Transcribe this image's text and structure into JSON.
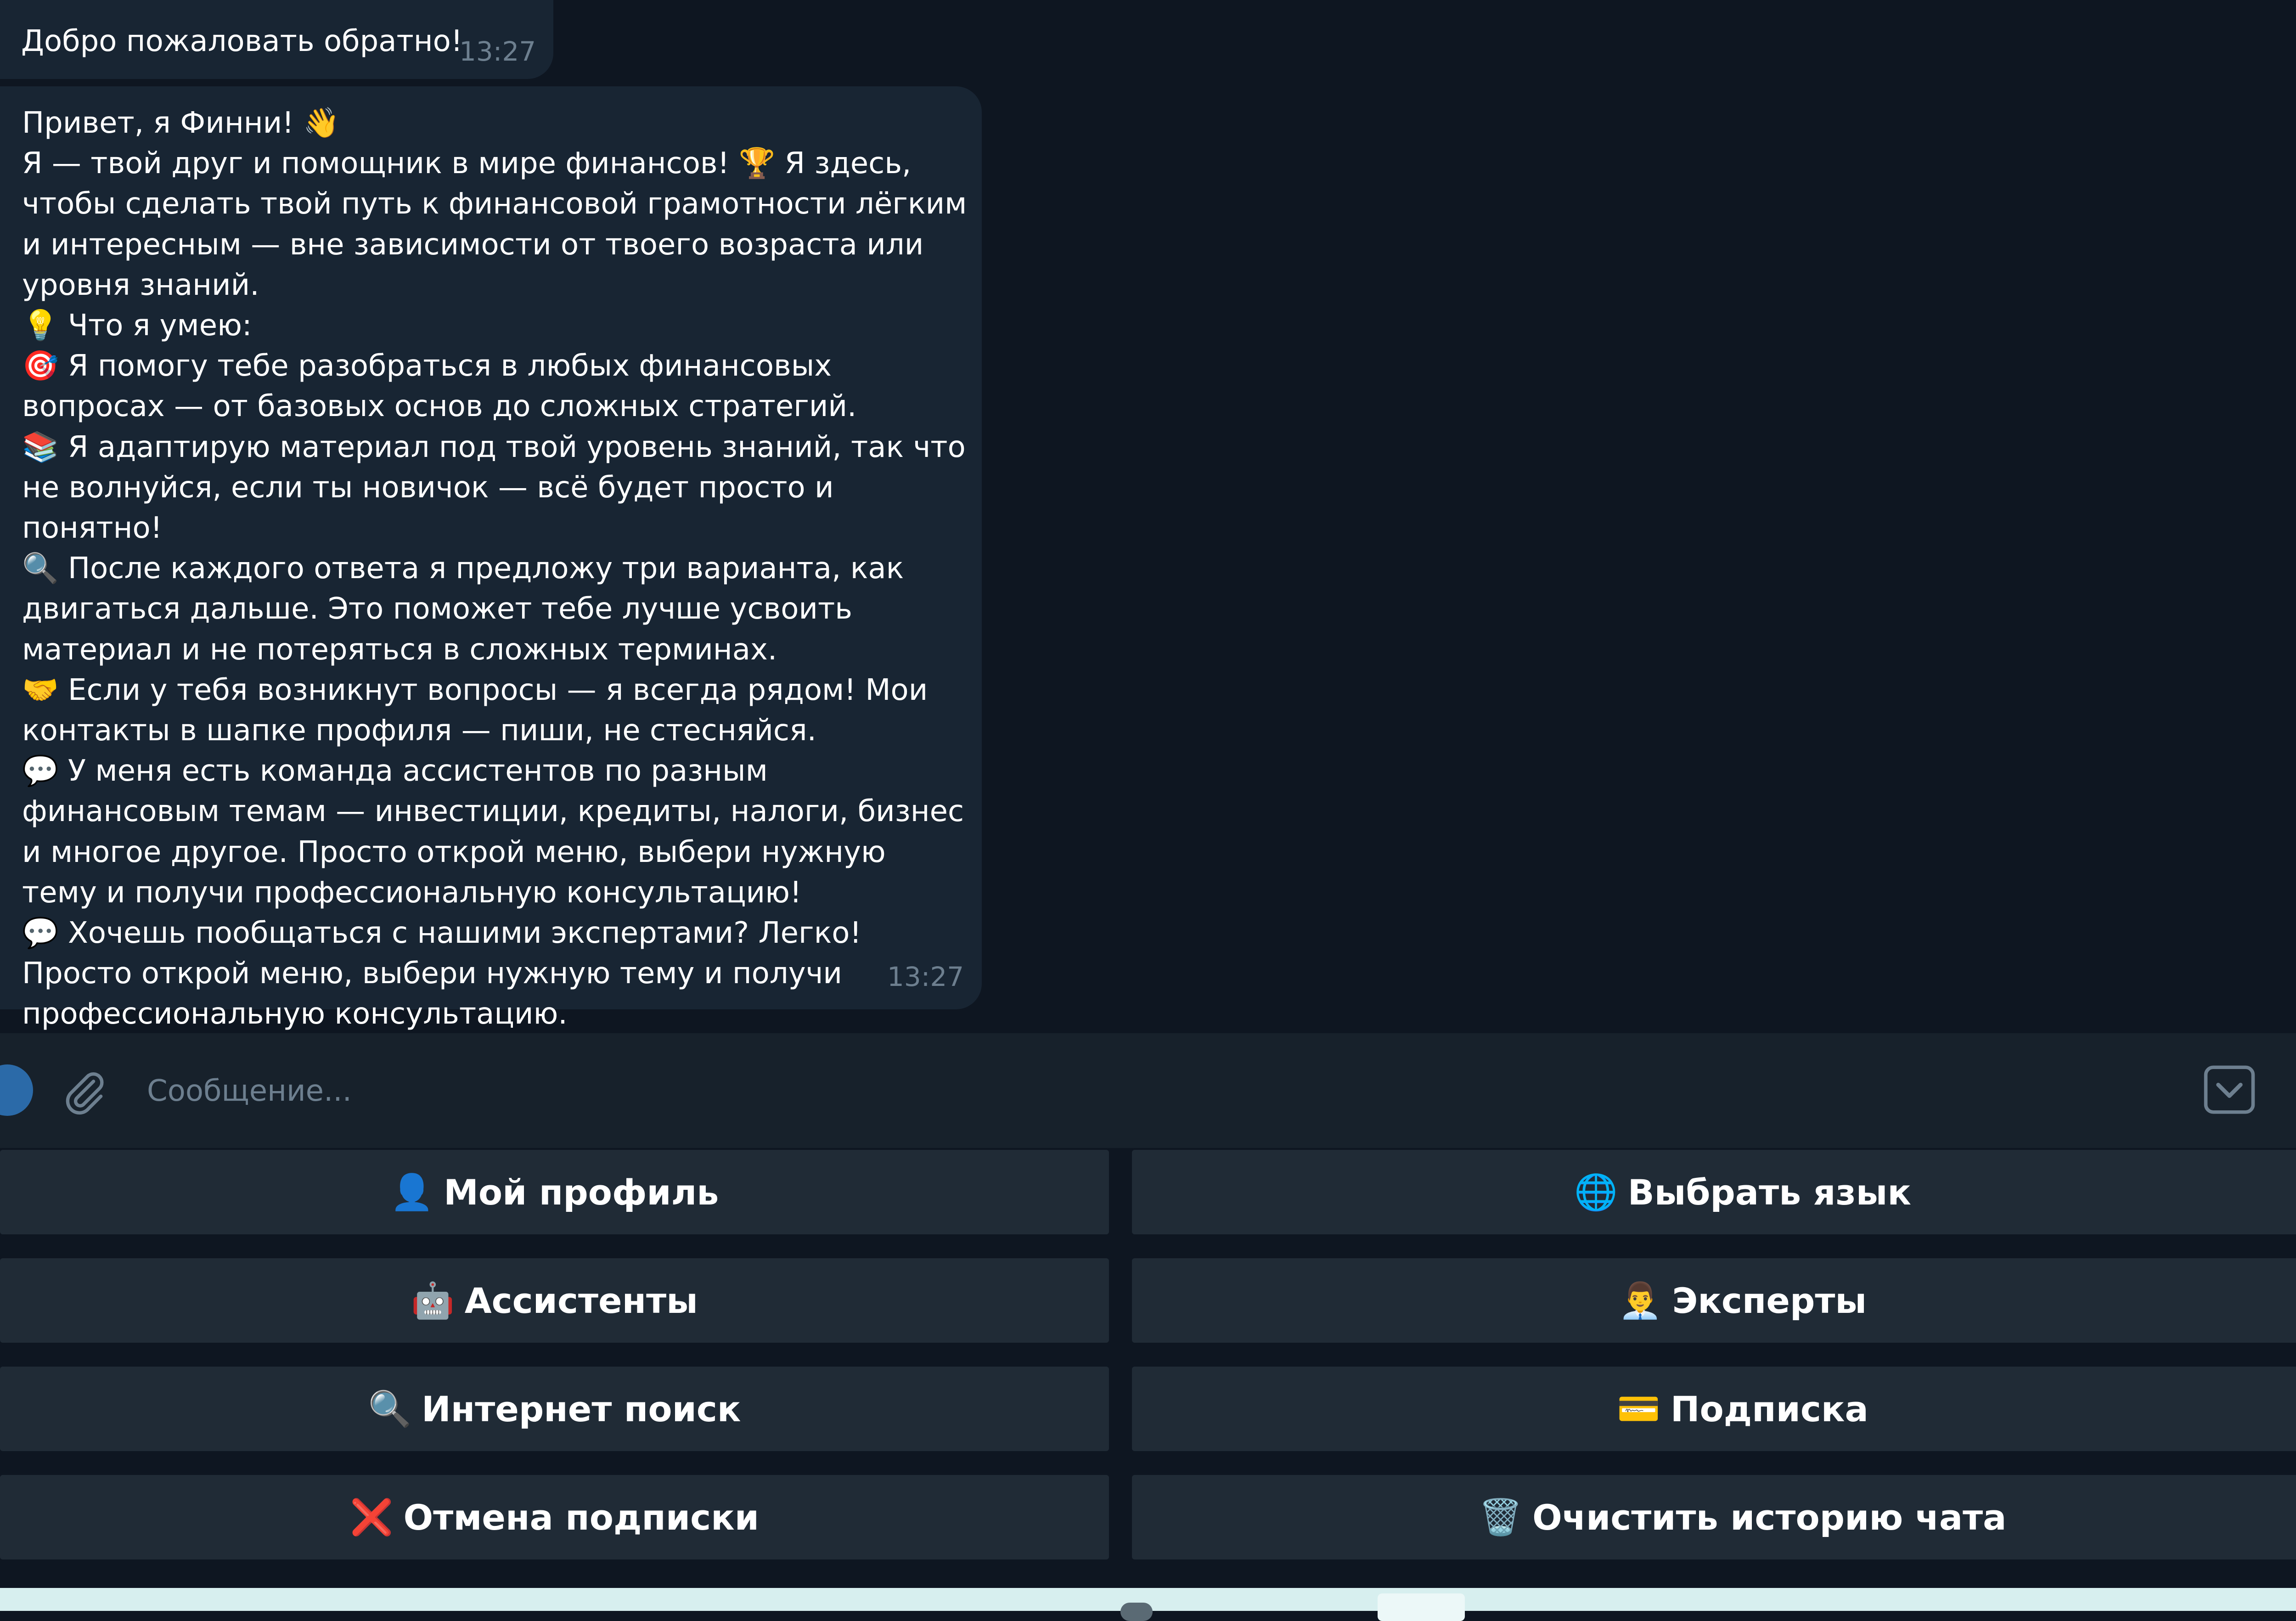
{
  "messages": [
    {
      "text": "Добро пожаловать обратно!",
      "time": "13:27"
    },
    {
      "text": "Привет, я Финни! 👋\nЯ — твой друг и помощник в мире финансов! 🏆 Я здесь, чтобы сделать твой путь к финансовой грамотности лёгким и интересным — вне зависимости от твоего возраста или уровня знаний.\n💡 Что я умею:\n🎯 Я помогу тебе разобраться в любых финансовых вопросах — от базовых основ до сложных стратегий.\n📚 Я адаптирую материал под твой уровень знаний, так что не волнуйся, если ты новичок — всё будет просто и понятно!\n🔍 После каждого ответа я предложу три варианта, как двигаться дальше. Это поможет тебе лучше усвоить материал и не потеряться в сложных терминах.\n🤝 Если у тебя возникнут вопросы — я всегда рядом! Мои контакты в шапке профиля — пиши, не стесняйся.\n💬 У меня есть команда ассистентов по разным финансовым темам — инвестиции, кредиты, налоги, бизнес и многое другое. Просто открой меню, выбери нужную тему и получи профессиональную консультацию!\n💬 Хочешь пообщаться с нашими экспертами? Легко! Просто открой меню, выбери нужную тему и получи профессиональную консультацию.",
      "time": "13:27"
    }
  ],
  "input": {
    "placeholder": "Сообщение..."
  },
  "keyboard": {
    "buttons": [
      {
        "icon": "👤",
        "label": "Мой профиль"
      },
      {
        "icon": "🌐",
        "label": "Выбрать язык"
      },
      {
        "icon": "🤖",
        "label": "Ассистенты"
      },
      {
        "icon": "👨‍💼",
        "label": "Эксперты"
      },
      {
        "icon": "🔍",
        "label": "Интернет поиск"
      },
      {
        "icon": "💳",
        "label": "Подписка"
      },
      {
        "icon": "❌",
        "label": "Отмена подписки"
      },
      {
        "icon": "🗑️",
        "label": "Очистить историю чата"
      }
    ]
  },
  "colors": {
    "background": "#0e1621",
    "bubble": "#182533",
    "input_bar": "#17212b",
    "key": "#202b36",
    "timestamp": "#6d7f8f",
    "accent": "#2b6aa8"
  }
}
